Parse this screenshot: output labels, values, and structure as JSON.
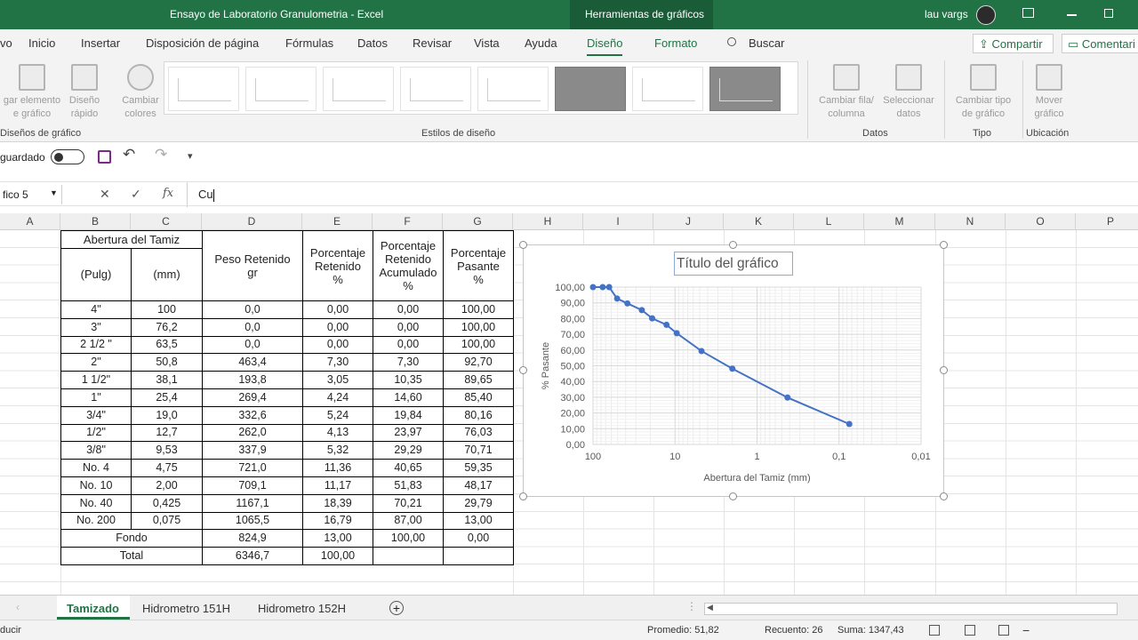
{
  "titlebar": {
    "doc_title": "Ensayo de Laboratorio Granulometria  -  Excel",
    "context_tab": "Herramientas de gráficos",
    "user": "lau vargs"
  },
  "ribbon_tabs": [
    "vo",
    "Inicio",
    "Insertar",
    "Disposición de página",
    "Fórmulas",
    "Datos",
    "Revisar",
    "Vista",
    "Ayuda",
    "Diseño",
    "Formato",
    "Buscar"
  ],
  "share": {
    "share": "Compartir",
    "comments": "Comentari"
  },
  "ribbon": {
    "add_element": [
      "gar elemento",
      "e gráfico"
    ],
    "quick_layout": [
      "Diseño",
      "rápido"
    ],
    "change_colors": [
      "Cambiar",
      "colores"
    ],
    "switch_row_col": [
      "Cambiar fila/",
      "columna"
    ],
    "select_data": [
      "Seleccionar",
      "datos"
    ],
    "change_type": [
      "Cambiar tipo",
      "de gráfico"
    ],
    "move_chart": [
      "Mover",
      "gráfico"
    ],
    "groups": {
      "layouts": "Diseños de gráfico",
      "styles": "Estilos de diseño",
      "data": "Datos",
      "type": "Tipo",
      "location": "Ubicación"
    }
  },
  "qat": {
    "autosave": "guardado"
  },
  "formula_bar": {
    "name_box": "fico 5",
    "content": "Cu"
  },
  "columns": [
    "A",
    "B",
    "C",
    "D",
    "E",
    "F",
    "G",
    "H",
    "I",
    "J",
    "K",
    "L",
    "M",
    "N",
    "O",
    "P"
  ],
  "table": {
    "h_abertura": "Abertura del Tamiz",
    "h_pulg": "(Pulg)",
    "h_mm": "(mm)",
    "h_peso": [
      "Peso Retenido",
      "gr"
    ],
    "h_pret": [
      "Porcentaje",
      "Retenido",
      "%"
    ],
    "h_pacum": [
      "Porcentaje",
      "Retenido",
      "Acumulado",
      "%"
    ],
    "h_ppas": [
      "Porcentaje",
      "Pasante",
      "%"
    ],
    "rows": [
      [
        "4\"",
        "100",
        "0,0",
        "0,00",
        "0,00",
        "100,00"
      ],
      [
        "3\"",
        "76,2",
        "0,0",
        "0,00",
        "0,00",
        "100,00"
      ],
      [
        "2 1/2 \"",
        "63,5",
        "0,0",
        "0,00",
        "0,00",
        "100,00"
      ],
      [
        "2\"",
        "50,8",
        "463,4",
        "7,30",
        "7,30",
        "92,70"
      ],
      [
        "1  1/2\"",
        "38,1",
        "193,8",
        "3,05",
        "10,35",
        "89,65"
      ],
      [
        "1\"",
        "25,4",
        "269,4",
        "4,24",
        "14,60",
        "85,40"
      ],
      [
        "3/4\"",
        "19,0",
        "332,6",
        "5,24",
        "19,84",
        "80,16"
      ],
      [
        "1/2\"",
        "12,7",
        "262,0",
        "4,13",
        "23,97",
        "76,03"
      ],
      [
        "3/8\"",
        "9,53",
        "337,9",
        "5,32",
        "29,29",
        "70,71"
      ],
      [
        "No. 4",
        "4,75",
        "721,0",
        "11,36",
        "40,65",
        "59,35"
      ],
      [
        "No. 10",
        "2,00",
        "709,1",
        "11,17",
        "51,83",
        "48,17"
      ],
      [
        "No. 40",
        "0,425",
        "1167,1",
        "18,39",
        "70,21",
        "29,79"
      ],
      [
        "No. 200",
        "0,075",
        "1065,5",
        "16,79",
        "87,00",
        "13,00"
      ]
    ],
    "fondo": [
      "Fondo",
      "824,9",
      "13,00",
      "100,00",
      "0,00"
    ],
    "total": [
      "Total",
      "6346,7",
      "100,00"
    ]
  },
  "chart_data": {
    "type": "scatter",
    "title": "Título del gráfico",
    "xlabel": "Abertura del Tamiz (mm)",
    "ylabel": "% Pasante",
    "xscale": "log",
    "xreversed": true,
    "xlim": [
      100,
      0.01
    ],
    "ylim": [
      0,
      100
    ],
    "xticks": [
      "100",
      "10",
      "1",
      "0,1",
      "0,01"
    ],
    "yticks": [
      "0,00",
      "10,00",
      "20,00",
      "30,00",
      "40,00",
      "50,00",
      "60,00",
      "70,00",
      "80,00",
      "90,00",
      "100,00"
    ],
    "grid": true,
    "x": [
      100,
      76.2,
      63.5,
      50.8,
      38.1,
      25.4,
      19.0,
      12.7,
      9.53,
      4.75,
      2.0,
      0.425,
      0.075
    ],
    "y": [
      100,
      100,
      100,
      92.7,
      89.65,
      85.4,
      80.16,
      76.03,
      70.71,
      59.35,
      48.17,
      29.79,
      13.0
    ],
    "color": "#4472c4"
  },
  "sheets": [
    "Tamizado",
    "Hidrometro  151H",
    "Hidrometro  152H"
  ],
  "status": {
    "mode": "ducir",
    "avg": "Promedio: 51,82",
    "count": "Recuento: 26",
    "sum": "Suma: 1347,43"
  },
  "colors": {
    "accent": "#217346",
    "series": "#4472c4"
  }
}
